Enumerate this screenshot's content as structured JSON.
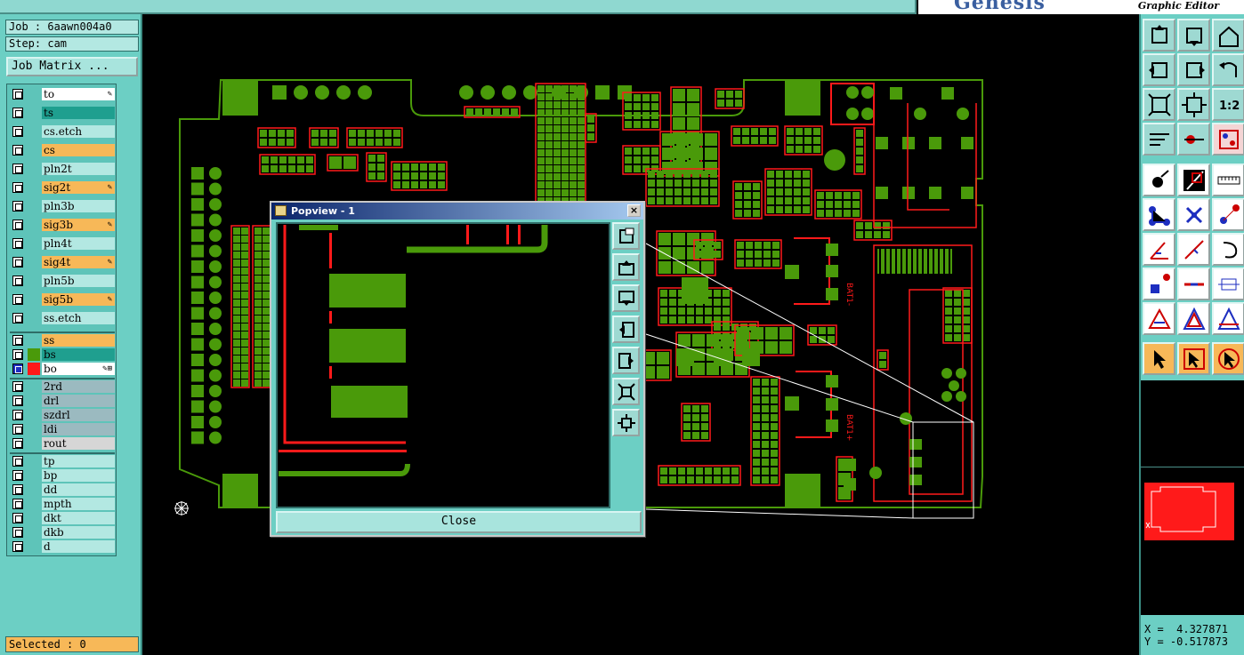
{
  "app": {
    "brand": "Genesis",
    "subtitle": "Graphic Editor"
  },
  "job_info": {
    "job": "Job : 6aawn004a0",
    "step": "Step: cam",
    "job_matrix_label": "Job Matrix ..."
  },
  "layers": [
    {
      "name": "to",
      "color": "#ffffff",
      "flag": "✎"
    },
    {
      "name": "ts",
      "color": "#1f9f8f",
      "flag": ""
    },
    {
      "name": "cs.etch",
      "color": "#b3e8e2",
      "flag": ""
    },
    {
      "name": "cs",
      "color": "#f7b858",
      "flag": ""
    },
    {
      "name": "pln2t",
      "color": "#b3e8e2",
      "flag": ""
    },
    {
      "name": "sig2t",
      "color": "#f7b858",
      "flag": "✎"
    },
    {
      "name": "pln3b",
      "color": "#b3e8e2",
      "flag": ""
    },
    {
      "name": "sig3b",
      "color": "#f7b858",
      "flag": "✎"
    },
    {
      "name": "pln4t",
      "color": "#b3e8e2",
      "flag": ""
    },
    {
      "name": "sig4t",
      "color": "#f7b858",
      "flag": "✎"
    },
    {
      "name": "pln5b",
      "color": "#b3e8e2",
      "flag": ""
    },
    {
      "name": "sig5b",
      "color": "#f7b858",
      "flag": "✎"
    },
    {
      "name": "ss.etch",
      "color": "#b3e8e2",
      "flag": ""
    },
    {
      "name": "ss",
      "color": "#f7b858",
      "flag": ""
    },
    {
      "name": "bs",
      "color": "#1f9f8f",
      "flag": ""
    },
    {
      "name": "bo",
      "color": "#ffffff",
      "flag": "✎⊞"
    },
    {
      "name": "2rd",
      "color": "#9bbac0",
      "flag": ""
    },
    {
      "name": "drl",
      "color": "#9bbac0",
      "flag": ""
    },
    {
      "name": "szdrl",
      "color": "#9bbac0",
      "flag": ""
    },
    {
      "name": "ldi",
      "color": "#9bbac0",
      "flag": ""
    },
    {
      "name": "rout",
      "color": "#d6d6d6",
      "flag": ""
    },
    {
      "name": "tp",
      "color": "#b3e8e2",
      "flag": ""
    },
    {
      "name": "bp",
      "color": "#b3e8e2",
      "flag": ""
    },
    {
      "name": "dd",
      "color": "#b3e8e2",
      "flag": ""
    },
    {
      "name": "mpth",
      "color": "#b3e8e2",
      "flag": ""
    },
    {
      "name": "dkt",
      "color": "#b3e8e2",
      "flag": ""
    },
    {
      "name": "dkb",
      "color": "#b3e8e2",
      "flag": ""
    },
    {
      "name": "d",
      "color": "#b3e8e2",
      "flag": ""
    }
  ],
  "status": {
    "selected": "Selected : 0"
  },
  "popview": {
    "title": "Popview - 1",
    "close_label": "Close",
    "close_x": "×"
  },
  "coords": {
    "x": "X =  4.327871",
    "y": "Y = -0.517873"
  },
  "board_labels": [
    "BAT1-",
    "BAT1+"
  ],
  "colors": {
    "copper": "#4a9a0a",
    "outline": "#ff1a1a",
    "panel": "#6ccfc4"
  }
}
